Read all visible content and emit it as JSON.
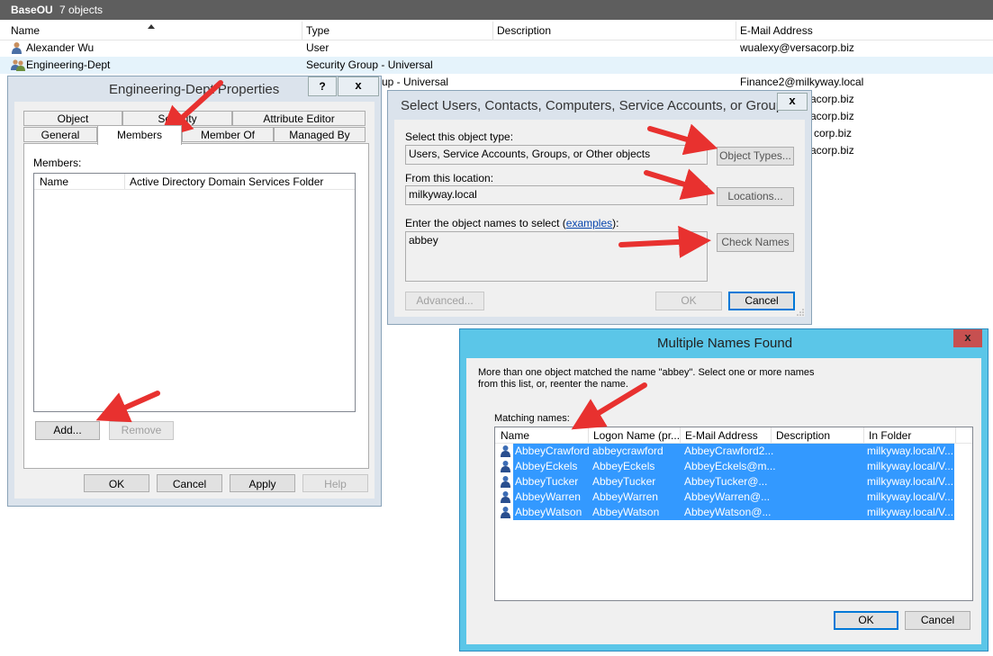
{
  "topbar": {
    "title": "BaseOU",
    "count": "7 objects"
  },
  "columns": {
    "name": "Name",
    "type": "Type",
    "description": "Description",
    "email": "E-Mail Address"
  },
  "rows": [
    {
      "name": "Alexander Wu",
      "type": "User",
      "email": "wualexy@versacorp.biz"
    },
    {
      "name": "Engineering-Dept",
      "type": "Security Group - Universal",
      "email": ""
    },
    {
      "type_partial": "up - Universal",
      "email": "Finance2@milkyway.local"
    },
    {
      "email_partial": "acorp.biz"
    },
    {
      "email_partial": "acorp.biz"
    },
    {
      "email_partial": "corp.biz"
    },
    {
      "email_partial": "acorp.biz"
    }
  ],
  "props": {
    "title": "Engineering-Dept Properties",
    "help_btn": "?",
    "close_btn": "x",
    "tabs_back": [
      "Object",
      "Security",
      "Attribute Editor"
    ],
    "tabs_front": [
      "General",
      "Members",
      "Member Of",
      "Managed By"
    ],
    "members_label": "Members:",
    "col_name": "Name",
    "col_folder": "Active Directory Domain Services Folder",
    "add": "Add...",
    "remove": "Remove",
    "ok": "OK",
    "cancel": "Cancel",
    "apply": "Apply",
    "help": "Help"
  },
  "select": {
    "title": "Select Users, Contacts, Computers, Service Accounts, or Groups",
    "close_btn": "x",
    "type_label": "Select this object type:",
    "type_value": "Users, Service Accounts, Groups, or Other objects",
    "object_types": "Object Types...",
    "location_label": "From this location:",
    "location_value": "milkyway.local",
    "locations": "Locations...",
    "enter_label": "Enter the object names to select (",
    "examples_link": "examples",
    "enter_label_end": "):",
    "entered_value": "abbey",
    "check_names": "Check Names",
    "advanced": "Advanced...",
    "ok": "OK",
    "cancel": "Cancel"
  },
  "multi": {
    "title": "Multiple Names Found",
    "close_btn": "x",
    "message_line1": "More than one object matched the name \"abbey\". Select one or more names",
    "message_line2": "from this list, or, reenter the name.",
    "matching_label": "Matching names:",
    "columns": [
      "Name",
      "Logon Name (pr...",
      "E-Mail Address",
      "Description",
      "In Folder"
    ],
    "rows": [
      {
        "name": "AbbeyCrawford",
        "logon": "abbeycrawford",
        "email": "AbbeyCrawford2...",
        "folder": "milkyway.local/V..."
      },
      {
        "name": "AbbeyEckels",
        "logon": "AbbeyEckels",
        "email": "AbbeyEckels@m...",
        "folder": "milkyway.local/V..."
      },
      {
        "name": "AbbeyTucker",
        "logon": "AbbeyTucker",
        "email": "AbbeyTucker@...",
        "folder": "milkyway.local/V..."
      },
      {
        "name": "AbbeyWarren",
        "logon": "AbbeyWarren",
        "email": "AbbeyWarren@...",
        "folder": "milkyway.local/V..."
      },
      {
        "name": "AbbeyWatson",
        "logon": "AbbeyWatson",
        "email": "AbbeyWatson@...",
        "folder": "milkyway.local/V..."
      }
    ],
    "ok": "OK",
    "cancel": "Cancel"
  },
  "colors": {
    "accent": "#3399ff",
    "title_bar_active": "#5bc6e8",
    "close_red": "#c75050",
    "arrow_red": "#e8312f"
  }
}
